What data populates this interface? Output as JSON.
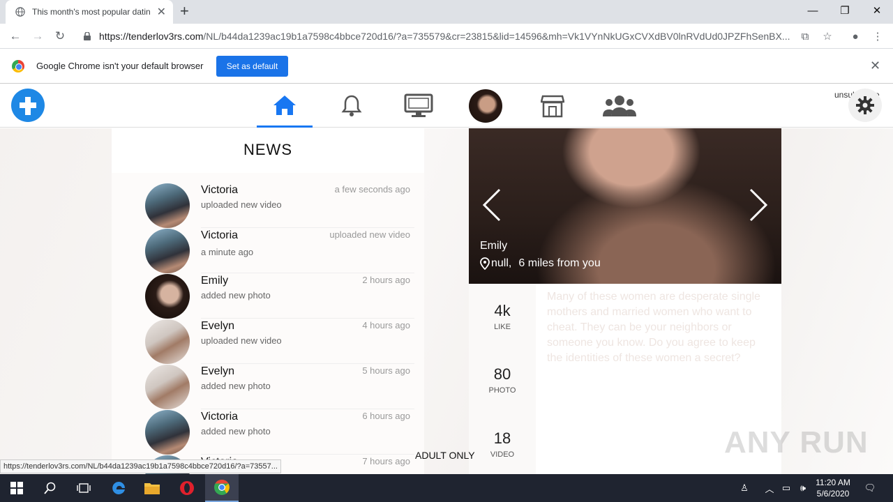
{
  "browser": {
    "tab_title": "This month's most popular datin",
    "url_host": "https://tenderlov3rs.com",
    "url_path": "/NL/b44da1239ac19b1a7598c4bbce720d16/?a=735579&cr=23815&lid=14596&mh=Vk1VYnNkUGxCVXdBV0lnRVdUd0JPZFhSenBX...",
    "infobar_text": "Google Chrome isn't your default browser",
    "set_default_label": "Set as default",
    "status_url": "https://tenderlov3rs.com/NL/b44da1239ac19b1a7598c4bbce720d16/?a=73557..."
  },
  "header": {
    "unsubscribe_label": "unsubscribe",
    "accent_color": "#1877f2"
  },
  "news": {
    "title": "NEWS",
    "items": [
      {
        "name": "Victoria",
        "subtitle": "uploaded new video",
        "time": "a few seconds ago",
        "avatar": "car"
      },
      {
        "name": "Victoria",
        "subtitle": "a minute ago",
        "time": "uploaded new video",
        "avatar": "car"
      },
      {
        "name": "Emily",
        "subtitle": "added new photo",
        "time": "2 hours ago",
        "avatar": "dark"
      },
      {
        "name": "Evelyn",
        "subtitle": "uploaded new video",
        "time": "4 hours ago",
        "avatar": "bed"
      },
      {
        "name": "Evelyn",
        "subtitle": "added new photo",
        "time": "5 hours ago",
        "avatar": "bed"
      },
      {
        "name": "Victoria",
        "subtitle": "added new photo",
        "time": "6 hours ago",
        "avatar": "car"
      },
      {
        "name": "Victoria",
        "subtitle": "",
        "time": "7 hours ago",
        "avatar": "car"
      }
    ]
  },
  "profile": {
    "name": "Emily",
    "location": "null,",
    "distance": "6  miles from you",
    "stats": [
      {
        "value": "4k",
        "label": "LIKE"
      },
      {
        "value": "80",
        "label": "PHOTO"
      },
      {
        "value": "18",
        "label": "VIDEO"
      }
    ],
    "description": "Many of these women are desperate single mothers and married women who want to cheat. They can be your neighbors or someone you know. Do you agree to keep the identities of these women a secret?"
  },
  "footer": {
    "adult_label": "ADULT ONLY",
    "watermark": "ANY RUN"
  },
  "taskbar": {
    "time": "11:20 AM",
    "date": "5/6/2020"
  }
}
